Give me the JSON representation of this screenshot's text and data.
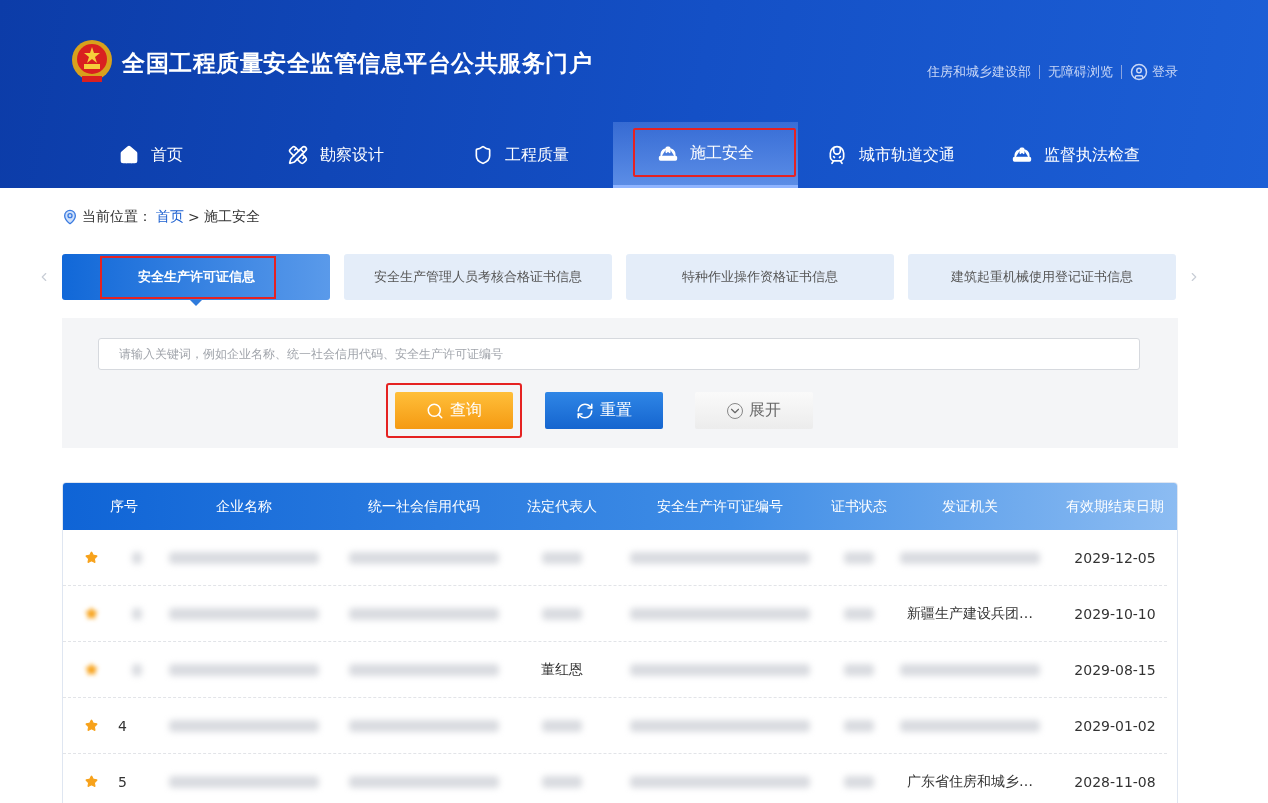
{
  "header": {
    "title": "全国工程质量安全监管信息平台公共服务门户",
    "links": [
      "住房和城乡建设部",
      "无障碍浏览"
    ],
    "login": "登录"
  },
  "nav": [
    {
      "label": "首页",
      "selected": false,
      "highlighted": false
    },
    {
      "label": "勘察设计",
      "selected": false,
      "highlighted": false
    },
    {
      "label": "工程质量",
      "selected": false,
      "highlighted": false
    },
    {
      "label": "施工安全",
      "selected": true,
      "highlighted": true
    },
    {
      "label": "城市轨道交通",
      "selected": false,
      "highlighted": false
    },
    {
      "label": "监督执法检查",
      "selected": false,
      "highlighted": false
    }
  ],
  "breadcrumb": {
    "prefix": "当前位置：",
    "home": "首页",
    "separator": ">",
    "current": "施工安全"
  },
  "tabs": [
    {
      "label": "安全生产许可证信息",
      "selected": true,
      "highlighted": true
    },
    {
      "label": "安全生产管理人员考核合格证书信息",
      "selected": false,
      "highlighted": false
    },
    {
      "label": "特种作业操作资格证书信息",
      "selected": false,
      "highlighted": false
    },
    {
      "label": "建筑起重机械使用登记证书信息",
      "selected": false,
      "highlighted": false
    }
  ],
  "search": {
    "placeholder": "请输入关键词，例如企业名称、统一社会信用代码、安全生产许可证编号"
  },
  "buttons": [
    {
      "kind": "query",
      "label": "查询",
      "highlighted": true
    },
    {
      "kind": "reset",
      "label": "重置"
    },
    {
      "kind": "expand",
      "label": "展开"
    }
  ],
  "table": {
    "columns": [
      "序号",
      "企业名称",
      "统一社会信用代码",
      "法定代表人",
      "安全生产许可证编号",
      "证书状态",
      "发证机关",
      "有效期结束日期"
    ],
    "rows": [
      {
        "starred": true,
        "star_blurred": false,
        "cells": [
          {
            "blurred": true
          },
          {
            "blurred": true
          },
          {
            "blurred": true
          },
          {
            "blurred": true
          },
          {
            "blurred": true
          },
          {
            "blurred": true
          },
          {
            "blurred": true
          },
          {
            "text": "2029-12-05",
            "blurred": false
          }
        ]
      },
      {
        "starred": true,
        "star_blurred": true,
        "cells": [
          {
            "blurred": true
          },
          {
            "blurred": true
          },
          {
            "blurred": true
          },
          {
            "blurred": true
          },
          {
            "blurred": true
          },
          {
            "blurred": true
          },
          {
            "text": "新疆生产建设兵团…",
            "blurred": false
          },
          {
            "text": "2029-10-10",
            "blurred": false
          }
        ]
      },
      {
        "starred": true,
        "star_blurred": true,
        "cells": [
          {
            "blurred": true
          },
          {
            "blurred": true
          },
          {
            "blurred": true
          },
          {
            "text": "董红恩",
            "blurred": false
          },
          {
            "blurred": true
          },
          {
            "blurred": true
          },
          {
            "blurred": true
          },
          {
            "text": "2029-08-15",
            "blurred": false
          }
        ]
      },
      {
        "starred": true,
        "star_blurred": false,
        "cells": [
          {
            "text": "4",
            "blurred": false
          },
          {
            "blurred": true
          },
          {
            "blurred": true
          },
          {
            "blurred": true
          },
          {
            "blurred": true
          },
          {
            "blurred": true
          },
          {
            "blurred": true
          },
          {
            "text": "2029-01-02",
            "blurred": false
          }
        ]
      },
      {
        "starred": true,
        "star_blurred": false,
        "cells": [
          {
            "text": "5",
            "blurred": false
          },
          {
            "blurred": true
          },
          {
            "blurred": true
          },
          {
            "blurred": true
          },
          {
            "blurred": true
          },
          {
            "blurred": true
          },
          {
            "text": "广东省住房和城乡…",
            "blurred": false
          },
          {
            "text": "2028-11-08",
            "blurred": false
          }
        ]
      }
    ]
  }
}
